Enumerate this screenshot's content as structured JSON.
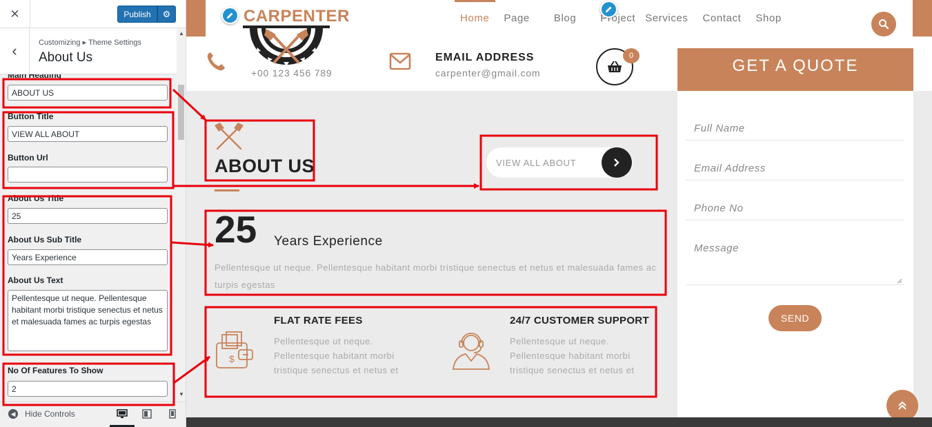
{
  "panel": {
    "close_icon": "close-icon",
    "publish_label": "Publish",
    "breadcrumb": "Customizing ▸ Theme Settings",
    "section_title": "About Us",
    "controls": {
      "main_heading": {
        "label": "Main Heading",
        "value": "ABOUT US"
      },
      "button_title": {
        "label": "Button Title",
        "value": "VIEW ALL ABOUT"
      },
      "button_url": {
        "label": "Button Url",
        "value": ""
      },
      "about_title": {
        "label": "About Us Title",
        "value": "25"
      },
      "about_subtitle": {
        "label": "About Us Sub Title",
        "value": "Years Experience"
      },
      "about_text": {
        "label": "About Us Text",
        "value": "Pellentesque ut neque. Pellentesque habitant morbi tristique senectus et netus et malesuada fames ac turpis egestas"
      },
      "features_count": {
        "label": "No Of Features To Show",
        "value": "2"
      }
    },
    "footer": {
      "hide_controls": "Hide Controls"
    }
  },
  "site": {
    "logo": "CARPENTER",
    "nav": [
      "Home",
      "Page",
      "Blog",
      "Project",
      "Services",
      "Contact",
      "Shop"
    ],
    "active_nav": "Home",
    "phone": "+00 123 456 789",
    "email_label": "EMAIL ADDRESS",
    "email": "carpenter@gmail.com",
    "cart_count": "0",
    "quote": {
      "title": "GET A QUOTE",
      "fields": [
        "Full Name",
        "Email Address",
        "Phone No"
      ],
      "message": "Message",
      "send": "SEND"
    },
    "about": {
      "heading": "ABOUT US",
      "button": "VIEW ALL ABOUT",
      "number": "25",
      "subtitle": "Years Experience",
      "text": "Pellentesque ut neque. Pellentesque habitant morbi tristique senectus et netus et malesuada fames ac turpis egestas",
      "features": [
        {
          "title": "FLAT RATE FEES",
          "text": "Pellentesque ut neque. Pellentesque habitant morbi tristique senectus et netus et"
        },
        {
          "title": "24/7 CUSTOMER SUPPORT",
          "text": "Pellentesque ut neque. Pellentesque habitant morbi tristique senectus et netus et"
        }
      ]
    }
  },
  "colors": {
    "accent": "#c8835a",
    "wp_blue": "#2271b1",
    "annotation": "#e8000b"
  }
}
